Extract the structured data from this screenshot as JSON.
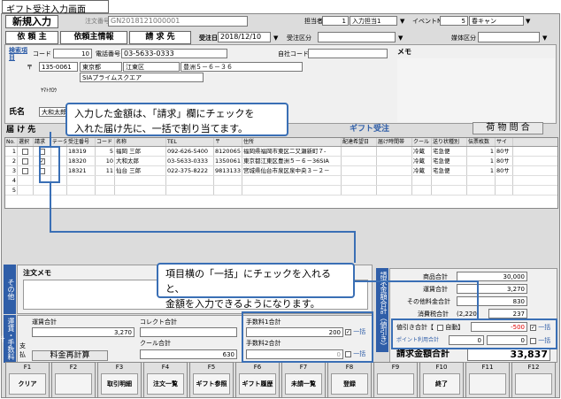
{
  "window_title": "ギフト受注入力画面",
  "header": {
    "mode": "新規入力",
    "order_no_label": "注文番号",
    "order_no_value": "GN2018121000001",
    "tanto_label": "担当者",
    "tanto_no": "1",
    "tanto_value": "入力担当1",
    "event_label": "イベントNo.",
    "event_no": "5",
    "event_value": "春キャン"
  },
  "tabs": {
    "irai": "依 頼 主",
    "irai_info": "依頼主情報",
    "seikyu": "請 求 先"
  },
  "order": {
    "date_label": "受注日",
    "date_value": "2018/12/10",
    "kubun_label": "受注区分",
    "baitai_label": "媒体区分"
  },
  "client": {
    "search_label": "検索項目",
    "code_label": "コード",
    "code_value": "10",
    "tel_label": "電話番号",
    "tel_value": "03-5633-0333",
    "jisha_label": "自社コード",
    "memo_label": "メモ",
    "zip_mark": "〒",
    "zip_value": "135-0061",
    "pref": "東京都",
    "city": "江東区",
    "addr1": "豊洲５－６－３６",
    "addr2": "SIAプライムスクエア",
    "kana": "ﾔﾏﾄｸﾛｳ",
    "name_label": "氏名",
    "name_value": "大和太郎"
  },
  "gift": {
    "section_label": "ギフト受注",
    "inquiry_button": "荷 物 問 合",
    "todoke_label": "届 け 先"
  },
  "grid": {
    "headers": [
      "No.",
      "選択",
      "請求",
      "テータス",
      "受注番号",
      "コード",
      "名称",
      "TEL",
      "〒",
      "住所",
      "配達希望日",
      "届け時間帯",
      "クール",
      "送り状種別",
      "伝票枚数",
      "サイ"
    ],
    "rows": [
      {
        "no": "1",
        "sel": false,
        "seikyu": false,
        "status": "",
        "order": "18319",
        "code": "5",
        "name": "福岡 三郎",
        "tel": "092-626-5400",
        "zip": "8120065",
        "addr": "福岡県福岡市東区二又瀬新町７-",
        "date": "",
        "time": "",
        "cool": "冷蔵",
        "slip": "宅急便",
        "count": "1",
        "size": "80サ"
      },
      {
        "no": "2",
        "sel": false,
        "seikyu": true,
        "status": "",
        "order": "18320",
        "code": "10",
        "name": "大和太郎",
        "tel": "03-5633-0333",
        "zip": "1350061",
        "addr": "東京都江東区豊洲５－６－36SIA",
        "date": "",
        "time": "",
        "cool": "冷蔵",
        "slip": "宅急便",
        "count": "1",
        "size": "80サ"
      },
      {
        "no": "3",
        "sel": false,
        "seikyu": false,
        "status": "",
        "order": "18321",
        "code": "11",
        "name": "仙台 三郎",
        "tel": "022-375-8222",
        "zip": "9813133",
        "addr": "宮城県仙台市泉区泉中央３－２－",
        "date": "",
        "time": "",
        "cool": "冷蔵",
        "slip": "宅急便",
        "count": "1",
        "size": "80サ"
      },
      {
        "no": "4"
      },
      {
        "no": "5"
      }
    ]
  },
  "callout1": {
    "line1": "入力した金額は、「請求」欄にチェックを",
    "line2": "入れた届け先に、一括で割り当てます。"
  },
  "callout2": {
    "line1": "項目横の「一括」にチェックを入れると、",
    "line2": "金額を入力できるようになります。"
  },
  "sonota": {
    "side_label": "その他",
    "memo_label": "注文メモ"
  },
  "unso": {
    "side_label": "運賃・手数料計",
    "unchin_label": "運賃合計",
    "unchin_value": "3,270",
    "collect_label": "コレクト合計",
    "cool_label": "クール合計",
    "cool_value": "630",
    "recalc_button": "料金再計算",
    "shiharai_label": "支払",
    "tesuryo1_label": "手数料1合計",
    "tesuryo1_value": "200",
    "tesuryo2_label": "手数料2合計",
    "tesuryo2_value": "0",
    "ikkatsu": "一括"
  },
  "totals": {
    "side_label": "請求金額合計（値引き）",
    "shohin_label": "商品合計",
    "shohin_value": "30,000",
    "unchin_label": "運賃合計",
    "unchin_value": "3,270",
    "other_label": "その他料金合計",
    "other_value": "830",
    "tax_label": "消費税合計",
    "tax_paren": "(2,220)",
    "tax_value": "237",
    "discount_label": "値引き合計【",
    "auto_label": "自動】",
    "discount_value": "-500",
    "point_label": "ポイント利用合計",
    "point_value1": "0",
    "point_value2": "0",
    "ikkatsu": "一括",
    "grand_label": "請求金額合計",
    "grand_value": "33,837"
  },
  "fkeys": [
    {
      "key": "F1",
      "label": "クリア"
    },
    {
      "key": "F2",
      "label": ""
    },
    {
      "key": "F3",
      "label": "取引明細"
    },
    {
      "key": "F4",
      "label": "注文一覧"
    },
    {
      "key": "F5",
      "label": "ギフト参照"
    },
    {
      "key": "F6",
      "label": "ギフト履歴"
    },
    {
      "key": "F7",
      "label": "未請一覧"
    },
    {
      "key": "F8",
      "label": "登録"
    },
    {
      "key": "F9",
      "label": ""
    },
    {
      "key": "F10",
      "label": "終了"
    },
    {
      "key": "F11",
      "label": ""
    },
    {
      "key": "F12",
      "label": ""
    }
  ],
  "colors": {
    "accent": "#3a6fb5",
    "side_blue": "#2f5ea8",
    "discount_red": "#e00000"
  }
}
